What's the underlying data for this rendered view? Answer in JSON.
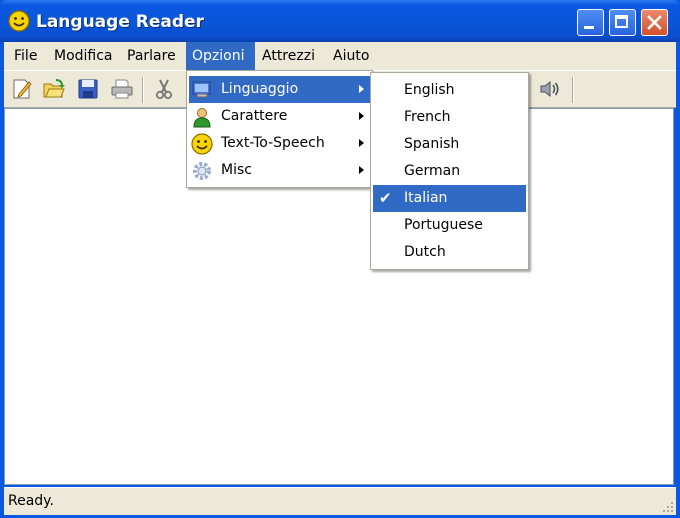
{
  "window": {
    "title": "Language Reader",
    "app_icon": "smiley-icon",
    "accent_color": "#0a57e0"
  },
  "menubar": {
    "items": [
      "File",
      "Modifica",
      "Parlare",
      "Opzioni",
      "Attrezzi",
      "Aiuto"
    ],
    "active": "Opzioni"
  },
  "toolbar": {
    "icons": [
      "new-document-icon",
      "open-folder-icon",
      "save-icon",
      "print-icon",
      "cut-icon",
      "speaker-icon"
    ]
  },
  "opzioni_menu": {
    "items": [
      {
        "label": "Linguaggio",
        "icon": "monitor-icon",
        "has_submenu": true,
        "highlighted": true
      },
      {
        "label": "Carattere",
        "icon": "person-icon",
        "has_submenu": true,
        "highlighted": false
      },
      {
        "label": "Text-To-Speech",
        "icon": "smiley-icon",
        "has_submenu": true,
        "highlighted": false
      },
      {
        "label": "Misc",
        "icon": "gear-icon",
        "has_submenu": true,
        "highlighted": false
      }
    ]
  },
  "language_submenu": {
    "items": [
      "English",
      "French",
      "Spanish",
      "German",
      "Italian",
      "Portuguese",
      "Dutch"
    ],
    "selected": "Italian"
  },
  "status": {
    "text": "Ready."
  }
}
